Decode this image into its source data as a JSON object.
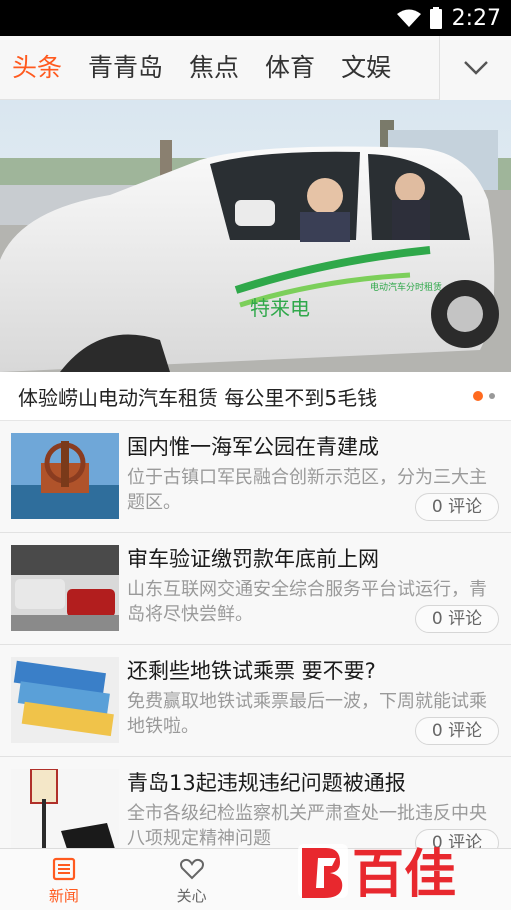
{
  "status_bar": {
    "time": "2:27",
    "icons": [
      "wifi-icon",
      "battery-icon"
    ]
  },
  "tabs": [
    {
      "label": "头条",
      "active": true
    },
    {
      "label": "青青岛",
      "active": false
    },
    {
      "label": "焦点",
      "active": false
    },
    {
      "label": "体育",
      "active": false
    },
    {
      "label": "文娱",
      "active": false
    }
  ],
  "tabs_more_icon": "chevron-down-icon",
  "hero": {
    "caption": "体验崂山电动汽车租赁 每公里不到5毛钱",
    "car_text": "特来电",
    "car_small_text": "电动汽车分时租赁",
    "pager": {
      "count": 2,
      "active_index": 0
    }
  },
  "news": [
    {
      "title": "国内惟一海军公园在青建成",
      "summary": "位于古镇口军民融合创新示范区，分为三大主题区。",
      "comments": "0 评论"
    },
    {
      "title": "审车验证缴罚款年底前上网",
      "summary": "山东互联网交通安全综合服务平台试运行，青岛将尽快尝鲜。",
      "comments": "0 评论"
    },
    {
      "title": "还剩些地铁试乘票 要不要?",
      "summary": "免费赢取地铁试乘票最后一波，下周就能试乘地铁啦。",
      "comments": "0 评论"
    },
    {
      "title": "青岛13起违规违纪问题被通报",
      "summary": "全市各级纪检监察机关严肃查处一批违反中央八项规定精神问题",
      "comments": "0 评论"
    }
  ],
  "bottom_nav": [
    {
      "label": "新闻",
      "icon": "news-icon",
      "active": true
    },
    {
      "label": "关心",
      "icon": "heart-icon",
      "active": false
    },
    {
      "label": "",
      "icon": "",
      "active": false
    },
    {
      "label": "",
      "icon": "",
      "active": false
    }
  ],
  "watermark": {
    "text": "百佳"
  },
  "colors": {
    "accent": "#ff5a1f",
    "text": "#222222",
    "muted": "#9a9a9a"
  }
}
